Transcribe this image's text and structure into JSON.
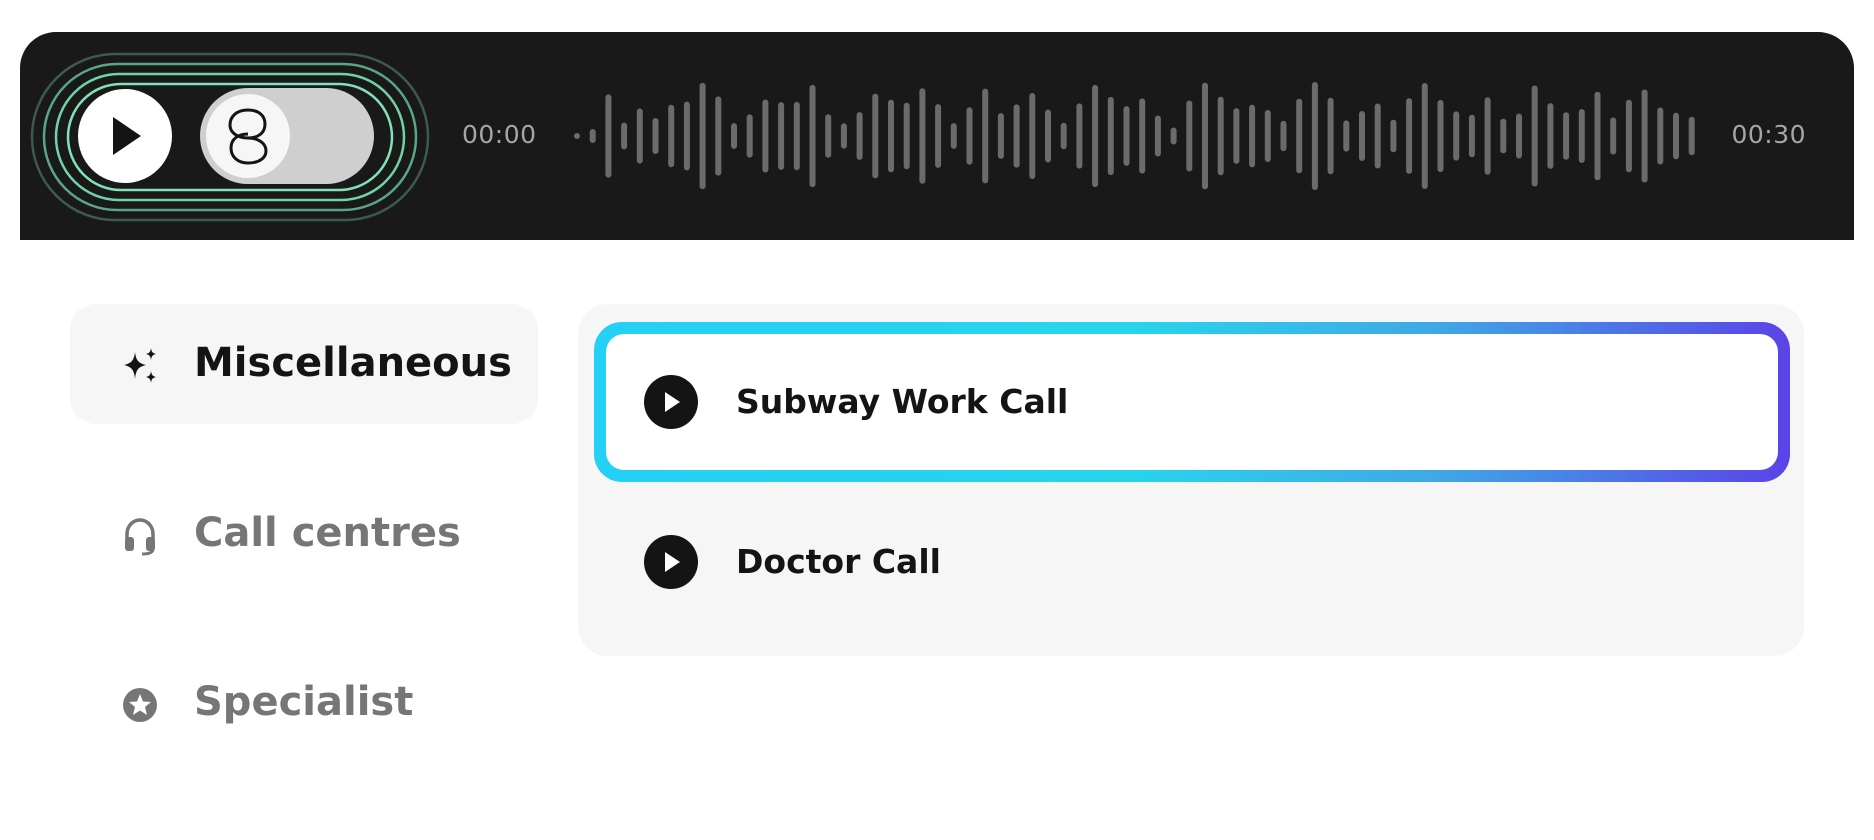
{
  "player": {
    "time_start": "00:00",
    "time_end": "00:30",
    "play_icon": "play-icon",
    "toggle_icon": "interlocking-rings-logo",
    "toggle_on": false,
    "progress": 0.0
  },
  "sidebar": {
    "items": [
      {
        "label": "Miscellaneous",
        "icon": "sparkles-icon",
        "active": true
      },
      {
        "label": "Call centres",
        "icon": "headset-icon",
        "active": false
      },
      {
        "label": "Specialist",
        "icon": "star-badge-icon",
        "active": false
      }
    ]
  },
  "calls": {
    "items": [
      {
        "title": "Subway Work Call",
        "selected": true
      },
      {
        "title": "Doctor Call",
        "selected": false
      }
    ]
  },
  "colors": {
    "player_bg": "#191919",
    "ring_color": "#6fd3a5",
    "waveform": "#6b6b6b",
    "selected_gradient_start": "#25d0f6",
    "selected_gradient_end": "#5a43e8",
    "panel_bg": "#f6f6f6",
    "text_dark": "#141414",
    "text_muted": "#767676"
  }
}
